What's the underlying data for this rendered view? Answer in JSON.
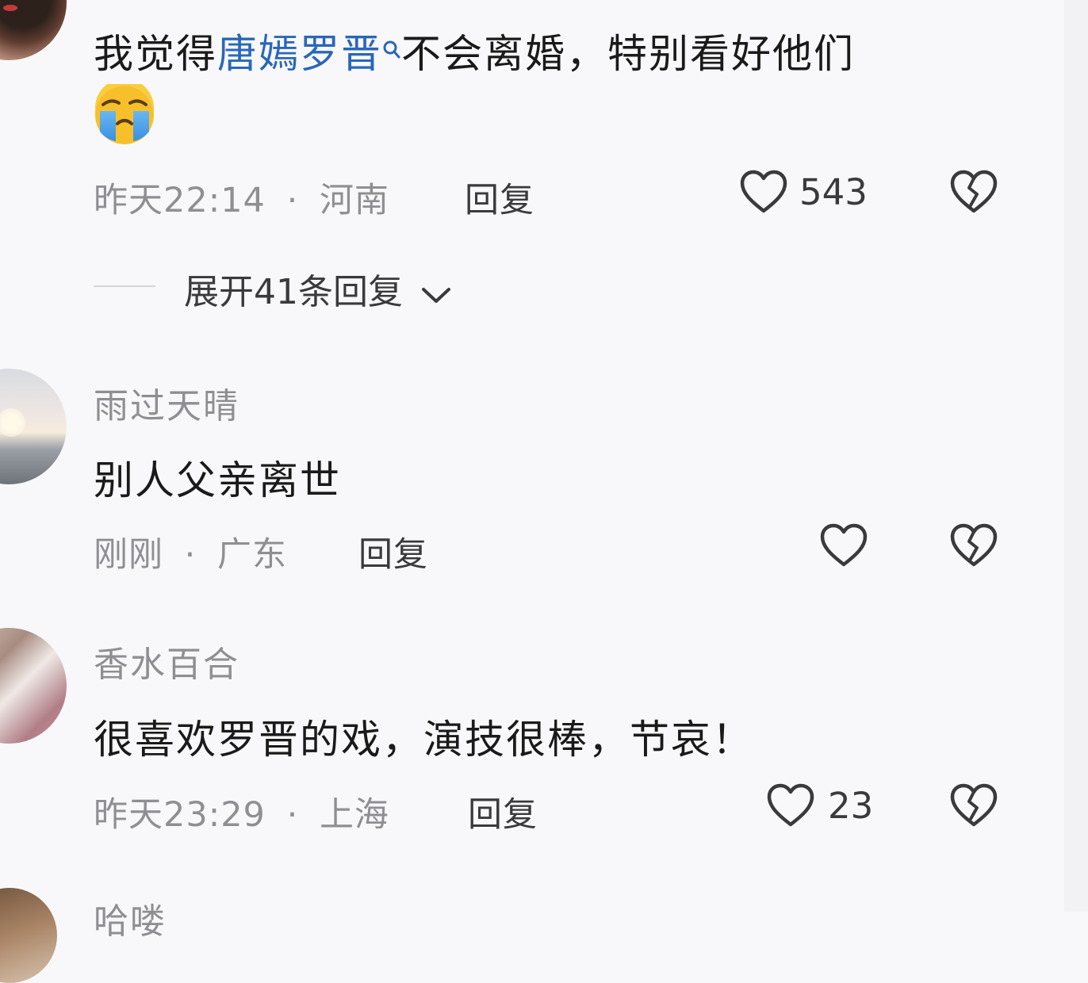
{
  "comments": [
    {
      "text_prefix": "我觉得",
      "mention": "唐嫣罗晋",
      "text_suffix": "不会离婚，特别看好他们",
      "emoji": "crying-face-emoji",
      "time": "昨天22:14",
      "location": "河南",
      "reply_label": "回复",
      "likes": "543",
      "expand_label": "展开41条回复"
    },
    {
      "username": "雨过天晴",
      "text": "别人父亲离世",
      "time": "刚刚",
      "location": "广东",
      "reply_label": "回复",
      "likes": ""
    },
    {
      "username": "香水百合",
      "text": "很喜欢罗晋的戏，演技很棒，节哀！",
      "time": "昨天23:29",
      "location": "上海",
      "reply_label": "回复",
      "likes": "23"
    },
    {
      "username_partial": "哈喽"
    }
  ],
  "meta_separator": "·",
  "colors": {
    "mention_link": "#2a67b8",
    "meta_text": "#8f8f93",
    "body_text": "#1a1a1a",
    "background": "#f8f8fa"
  }
}
